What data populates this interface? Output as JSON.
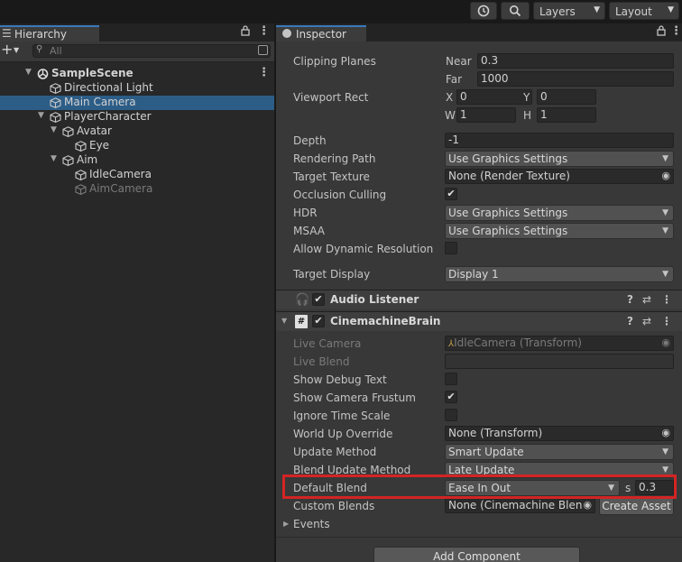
{
  "toolbar": {
    "history_icon": "history-icon",
    "search_icon": "search-icon",
    "layers": {
      "label": "Layers"
    },
    "layout": {
      "label": "Layout"
    }
  },
  "hierarchy": {
    "tab_label": "Hierarchy",
    "search_placeholder": "All",
    "items": [
      {
        "label": "SampleScene",
        "level": 0,
        "expanded": true,
        "kind": "scene",
        "selected": false,
        "dim": false
      },
      {
        "label": "Directional Light",
        "level": 1,
        "kind": "object",
        "selected": false,
        "dim": false
      },
      {
        "label": "Main Camera",
        "level": 1,
        "kind": "object",
        "selected": true,
        "dim": false
      },
      {
        "label": "PlayerCharacter",
        "level": 1,
        "expanded": true,
        "kind": "object",
        "selected": false,
        "dim": false
      },
      {
        "label": "Avatar",
        "level": 2,
        "expanded": true,
        "kind": "object",
        "selected": false,
        "dim": false
      },
      {
        "label": "Eye",
        "level": 3,
        "kind": "object",
        "selected": false,
        "dim": false
      },
      {
        "label": "Aim",
        "level": 2,
        "expanded": true,
        "kind": "object",
        "selected": false,
        "dim": false
      },
      {
        "label": "IdleCamera",
        "level": 3,
        "kind": "object",
        "selected": false,
        "dim": false
      },
      {
        "label": "AimCamera",
        "level": 3,
        "kind": "object",
        "selected": false,
        "dim": true
      }
    ]
  },
  "inspector": {
    "tab_label": "Inspector",
    "camera": {
      "clipping_planes_label": "Clipping Planes",
      "near_label": "Near",
      "near_value": "0.3",
      "far_label": "Far",
      "far_value": "1000",
      "viewport_rect_label": "Viewport Rect",
      "x_label": "X",
      "x_value": "0",
      "y_label": "Y",
      "y_value": "0",
      "w_label": "W",
      "w_value": "1",
      "h_label": "H",
      "h_value": "1",
      "depth_label": "Depth",
      "depth_value": "-1",
      "rendering_path_label": "Rendering Path",
      "rendering_path_value": "Use Graphics Settings",
      "target_texture_label": "Target Texture",
      "target_texture_value": "None (Render Texture)",
      "occlusion_culling_label": "Occlusion Culling",
      "occlusion_culling_checked": true,
      "hdr_label": "HDR",
      "hdr_value": "Use Graphics Settings",
      "msaa_label": "MSAA",
      "msaa_value": "Use Graphics Settings",
      "allow_dynamic_resolution_label": "Allow Dynamic Resolution",
      "allow_dynamic_resolution_checked": false,
      "target_display_label": "Target Display",
      "target_display_value": "Display 1"
    },
    "audio_listener": {
      "title": "Audio Listener",
      "enabled": true
    },
    "cinemachine_brain": {
      "title": "CinemachineBrain",
      "enabled": true,
      "live_camera_label": "Live Camera",
      "live_camera_value": "IdleCamera (Transform)",
      "live_blend_label": "Live Blend",
      "live_blend_value": "",
      "show_debug_text_label": "Show Debug Text",
      "show_debug_text_checked": false,
      "show_camera_frustum_label": "Show Camera Frustum",
      "show_camera_frustum_checked": true,
      "ignore_time_scale_label": "Ignore Time Scale",
      "ignore_time_scale_checked": false,
      "world_up_override_label": "World Up Override",
      "world_up_override_value": "None (Transform)",
      "update_method_label": "Update Method",
      "update_method_value": "Smart Update",
      "blend_update_method_label": "Blend Update Method",
      "blend_update_method_value": "Late Update",
      "default_blend_label": "Default Blend",
      "default_blend_value": "Ease In Out",
      "default_blend_unit": "s",
      "default_blend_time": "0.3",
      "custom_blends_label": "Custom Blends",
      "custom_blends_value": "None (Cinemachine Blenc",
      "create_asset_label": "Create Asset",
      "events_label": "Events"
    },
    "add_component_label": "Add Component"
  },
  "colors": {
    "selection": "#2c5d87",
    "highlight_box": "#d42424",
    "accent_tab": "#3a79bb"
  }
}
